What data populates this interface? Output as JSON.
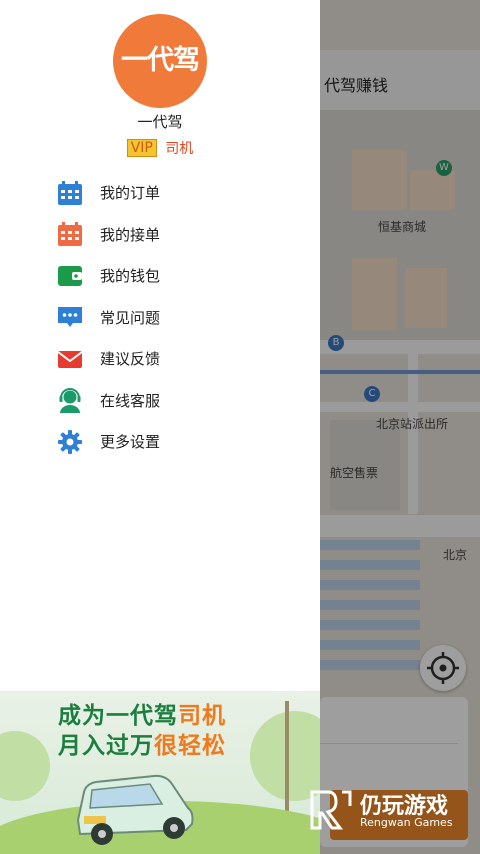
{
  "map": {
    "header_title": "代驾赚钱",
    "labels": {
      "mall": "恒基商城",
      "police": "北京站派出所",
      "ticket": "航空售票",
      "north": "北京"
    },
    "poi_letters": {
      "b": "B",
      "c": "C",
      "w": "W"
    }
  },
  "drawer": {
    "avatar_text": "一代驾",
    "user_name": "一代驾",
    "vip_badge": "VIP",
    "role": "司机",
    "menu": [
      {
        "label": "我的订单",
        "icon": "calendar-icon",
        "color": "#2e7fd6"
      },
      {
        "label": "我的接单",
        "icon": "calendar-check-icon",
        "color": "#f06a44"
      },
      {
        "label": "我的钱包",
        "icon": "wallet-icon",
        "color": "#1b9a4a"
      },
      {
        "label": "常见问题",
        "icon": "chat-bubble-icon",
        "color": "#2e7fd6"
      },
      {
        "label": "建议反馈",
        "icon": "envelope-icon",
        "color": "#e63b2e"
      },
      {
        "label": "在线客服",
        "icon": "headset-agent-icon",
        "color": "#1b9a6a"
      },
      {
        "label": "更多设置",
        "icon": "gear-icon",
        "color": "#2e7fd6"
      }
    ]
  },
  "banner": {
    "line1_prefix": "成为一代驾",
    "line1_highlight": "司机",
    "line2_prefix": "月入过万",
    "line2_highlight": "很轻松"
  },
  "watermark": {
    "name": "仍玩游戏",
    "sub": "Rengwan Games"
  }
}
